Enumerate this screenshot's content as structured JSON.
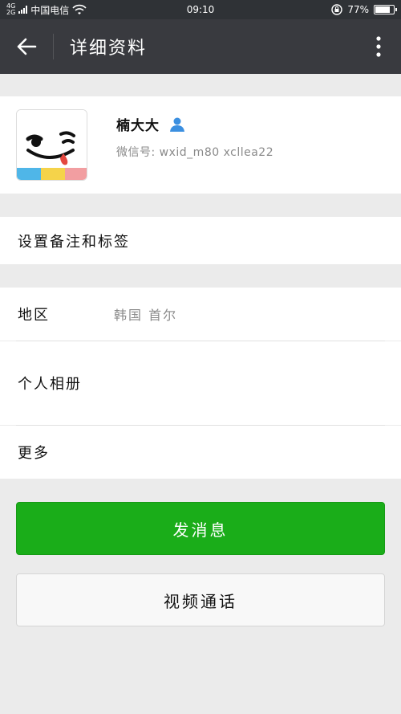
{
  "statusbar": {
    "network_top": "4G",
    "network_bottom": "2G",
    "carrier": "中国电信",
    "time": "09:10",
    "battery_percent": "77%",
    "battery_level": 0.77
  },
  "header": {
    "title": "详细资料",
    "back_icon": "arrow-left-icon",
    "more_icon": "more-vertical-icon"
  },
  "profile": {
    "name": "楠大大",
    "wechat_id_label": "微信号:",
    "wechat_id": "wxid_m80 xcllea22",
    "gender_icon": "user-male-icon"
  },
  "rows": {
    "remark": "设置备注和标签",
    "region_label": "地区",
    "region_value": "韩国 首尔",
    "album": "个人相册",
    "more": "更多"
  },
  "actions": {
    "send_message": "发消息",
    "video_call": "视频通话"
  },
  "colors": {
    "titlebar": "#393a3f",
    "primary": "#1aad19",
    "background": "#ebebeb"
  }
}
